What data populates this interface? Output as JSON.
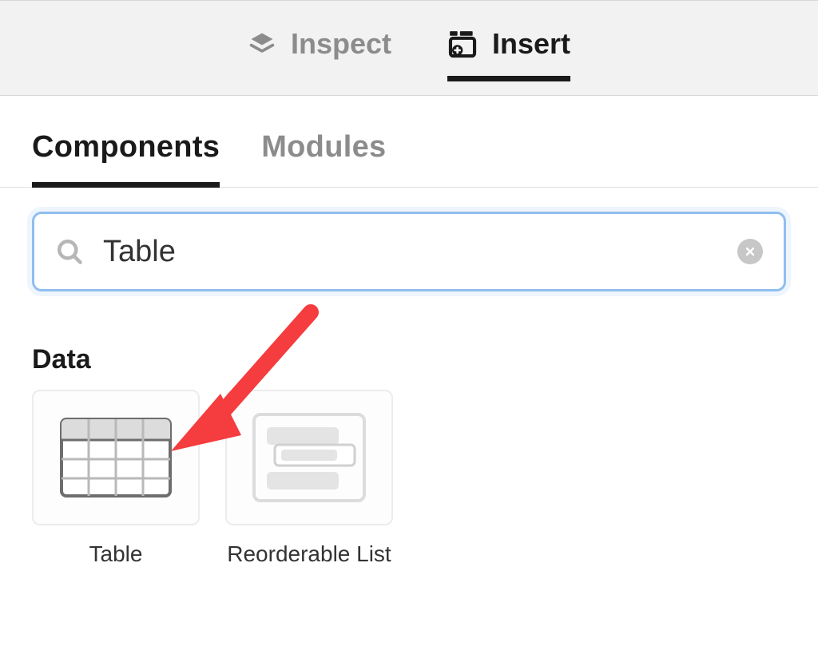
{
  "top_tabs": {
    "inspect": {
      "label": "Inspect",
      "active": false
    },
    "insert": {
      "label": "Insert",
      "active": true
    }
  },
  "sub_tabs": {
    "components": {
      "label": "Components",
      "active": true
    },
    "modules": {
      "label": "Modules",
      "active": false
    }
  },
  "search": {
    "value": "Table",
    "placeholder": "Search"
  },
  "section": {
    "heading": "Data",
    "items": [
      {
        "name": "table-component",
        "label": "Table"
      },
      {
        "name": "reorderable-list-component",
        "label": "Reorderable List"
      }
    ]
  },
  "annotation": {
    "arrow_color": "#f53c3e"
  }
}
